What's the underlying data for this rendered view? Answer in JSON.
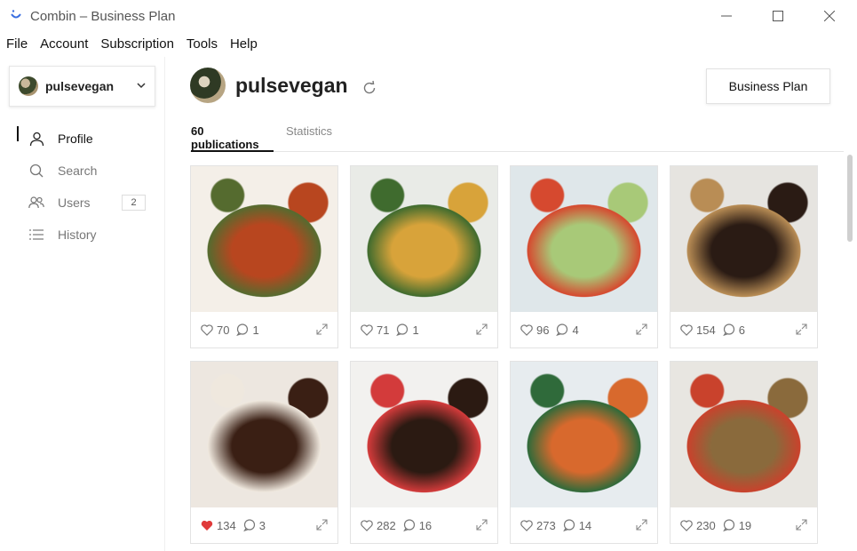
{
  "window": {
    "title": "Combin – Business Plan"
  },
  "menu": [
    "File",
    "Account",
    "Subscription",
    "Tools",
    "Help"
  ],
  "sidebar": {
    "account": "pulsevegan",
    "items": [
      {
        "label": "Profile",
        "icon": "user-icon",
        "active": true
      },
      {
        "label": "Search",
        "icon": "search-icon"
      },
      {
        "label": "Users",
        "icon": "users-icon",
        "badge": "2"
      },
      {
        "label": "History",
        "icon": "list-icon"
      }
    ]
  },
  "profile": {
    "name": "pulsevegan",
    "plan_button": "Business Plan",
    "tabs": [
      "60 publications",
      "Statistics"
    ]
  },
  "posts": [
    {
      "likes": "70",
      "comments": "1",
      "liked": false,
      "colors": [
        "#f4efe8",
        "#b8461f",
        "#556b2f"
      ]
    },
    {
      "likes": "71",
      "comments": "1",
      "liked": false,
      "colors": [
        "#e9ebe7",
        "#d8a33a",
        "#3f6b2e"
      ]
    },
    {
      "likes": "96",
      "comments": "4",
      "liked": false,
      "colors": [
        "#dfe7ea",
        "#a8c978",
        "#d6492f"
      ]
    },
    {
      "likes": "154",
      "comments": "6",
      "liked": false,
      "colors": [
        "#e6e4e0",
        "#2a1b14",
        "#b98d55"
      ]
    },
    {
      "likes": "134",
      "comments": "3",
      "liked": true,
      "colors": [
        "#ede7e0",
        "#3a1f14",
        "#efe8de"
      ]
    },
    {
      "likes": "282",
      "comments": "16",
      "liked": false,
      "colors": [
        "#f2f1ef",
        "#2b1a12",
        "#d33b3b"
      ]
    },
    {
      "likes": "273",
      "comments": "14",
      "liked": false,
      "colors": [
        "#e7ecef",
        "#d8692d",
        "#2f6a3a"
      ]
    },
    {
      "likes": "230",
      "comments": "19",
      "liked": false,
      "colors": [
        "#e8e6e1",
        "#8a6a3c",
        "#c9422c"
      ]
    }
  ]
}
